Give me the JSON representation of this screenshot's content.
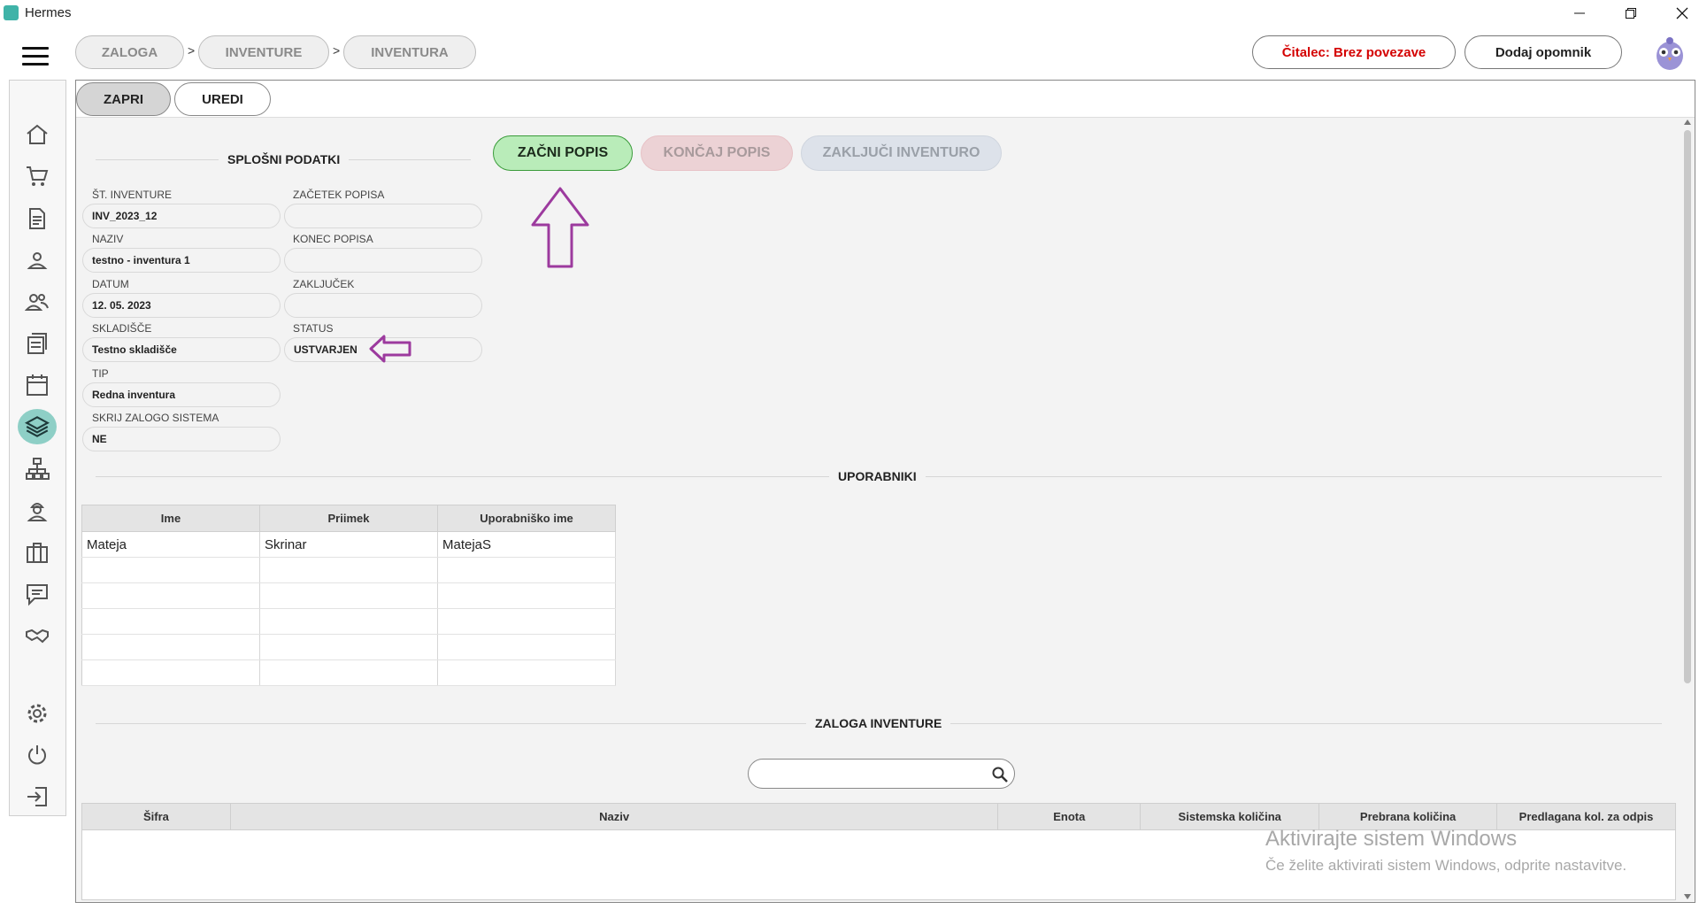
{
  "window": {
    "title": "Hermes",
    "controls": [
      "minimize",
      "restore",
      "close"
    ]
  },
  "breadcrumb": [
    "ZALOGA",
    "INVENTURE",
    "INVENTURA"
  ],
  "breadcrumb_separator": ">",
  "topbar": {
    "reader_status": "Čitalec: Brez povezave",
    "add_reminder": "Dodaj opomnik"
  },
  "tabs": [
    "ZAPRI",
    "UREDI"
  ],
  "actions": {
    "start": "ZAČNI POPIS",
    "end": "KONČAJ POPIS",
    "close_inventory": "ZAKLJUČI INVENTURO"
  },
  "general": {
    "title": "SPLOŠNI PODATKI",
    "fields": {
      "inventory_no": {
        "label": "ŠT. INVENTURE",
        "value": "INV_2023_12"
      },
      "name": {
        "label": "NAZIV",
        "value": "testno - inventura 1"
      },
      "date": {
        "label": "DATUM",
        "value": "12. 05. 2023"
      },
      "warehouse": {
        "label": "SKLADIŠČE",
        "value": "Testno skladišče"
      },
      "type": {
        "label": "TIP",
        "value": "Redna inventura"
      },
      "hide_stock": {
        "label": "SKRIJ ZALOGO SISTEMA",
        "value": "NE"
      },
      "count_start": {
        "label": "ZAČETEK POPISA",
        "value": ""
      },
      "count_end": {
        "label": "KONEC POPISA",
        "value": ""
      },
      "conclusion": {
        "label": "ZAKLJUČEK",
        "value": ""
      },
      "status": {
        "label": "STATUS",
        "value": "USTVARJEN"
      }
    }
  },
  "users": {
    "title": "UPORABNIKI",
    "columns": [
      "Ime",
      "Priimek",
      "Uporabniško ime"
    ],
    "rows": [
      [
        "Mateja",
        "Skrinar",
        "MatejaS"
      ]
    ]
  },
  "stock": {
    "title": "ZALOGA INVENTURE",
    "search_placeholder": "",
    "columns": [
      "Šifra",
      "Naziv",
      "Enota",
      "Sistemska količina",
      "Prebrana količina",
      "Predlagana kol. za odpis"
    ]
  },
  "watermark": {
    "line1": "Aktivirajte sistem Windows",
    "line2": "Če želite aktivirati sistem Windows, odprite nastavitve."
  },
  "colors": {
    "start_button": "#b9ecb9",
    "end_button_disabled": "#ecd2d5",
    "close_button_disabled": "#dde2ea",
    "reader_status_text": "#d40000",
    "annotation_arrow": "#9c3a9e",
    "sidebar_active": "#8ecfc6"
  },
  "sidebar_icons": [
    "home-icon",
    "cart-icon",
    "document-icon",
    "person-icon",
    "people-icon",
    "list-icon",
    "calendar-icon",
    "layers-icon",
    "hierarchy-icon",
    "worker-icon",
    "briefcase-icon",
    "chat-icon",
    "handshake-icon",
    "settings-icon",
    "power-icon",
    "logout-icon"
  ]
}
